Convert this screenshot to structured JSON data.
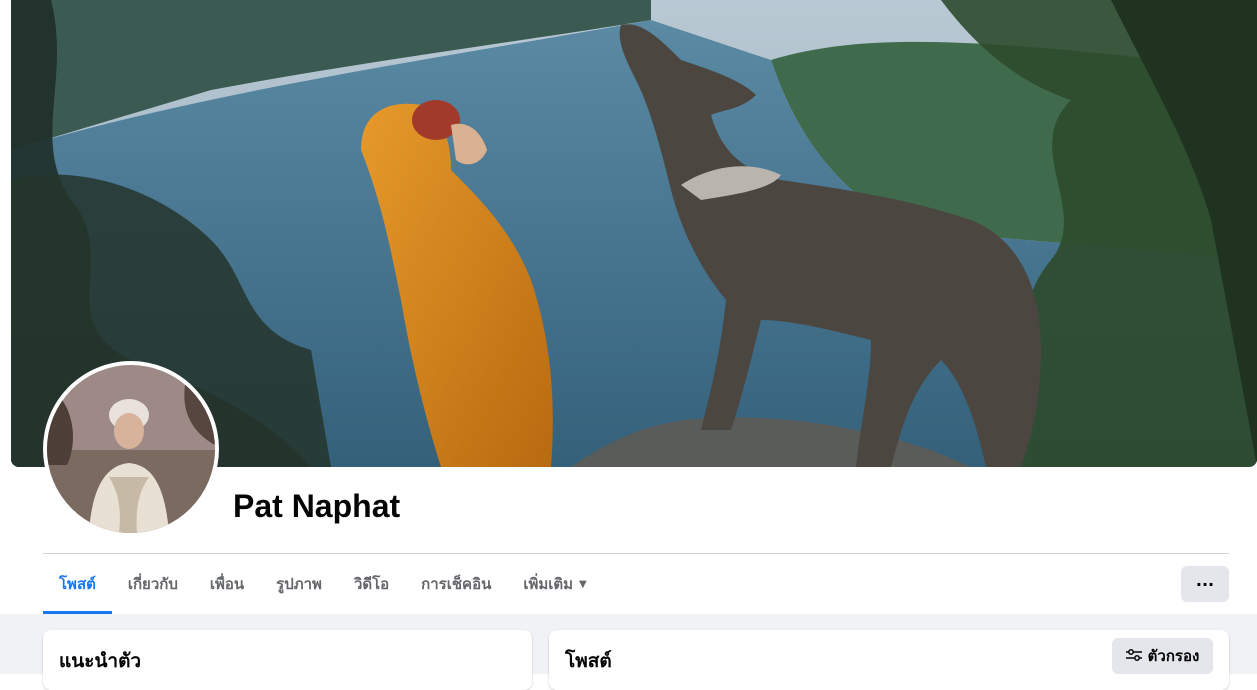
{
  "profile": {
    "name": "Pat Naphat"
  },
  "tabs": [
    {
      "label": "โพสต์",
      "active": true
    },
    {
      "label": "เกี่ยวกับ",
      "active": false
    },
    {
      "label": "เพื่อน",
      "active": false
    },
    {
      "label": "รูปภาพ",
      "active": false
    },
    {
      "label": "วิดีโอ",
      "active": false
    },
    {
      "label": "การเช็คอิน",
      "active": false
    },
    {
      "label": "เพิ่มเติม",
      "active": false,
      "dropdown": true
    }
  ],
  "more_button": {
    "label": "···"
  },
  "intro_card": {
    "title": "แนะนำตัว"
  },
  "posts_card": {
    "title": "โพสต์",
    "filter_label": "ตัวกรอง"
  },
  "icons": {
    "more": "more-horizontal-icon",
    "filter": "filter-sliders-icon",
    "dropdown": "caret-down-icon"
  },
  "colors": {
    "accent": "#1877f2",
    "text_primary": "#050505",
    "text_secondary": "#65676b",
    "feed_background": "#f0f2f5",
    "button_background": "#e4e6eb"
  }
}
